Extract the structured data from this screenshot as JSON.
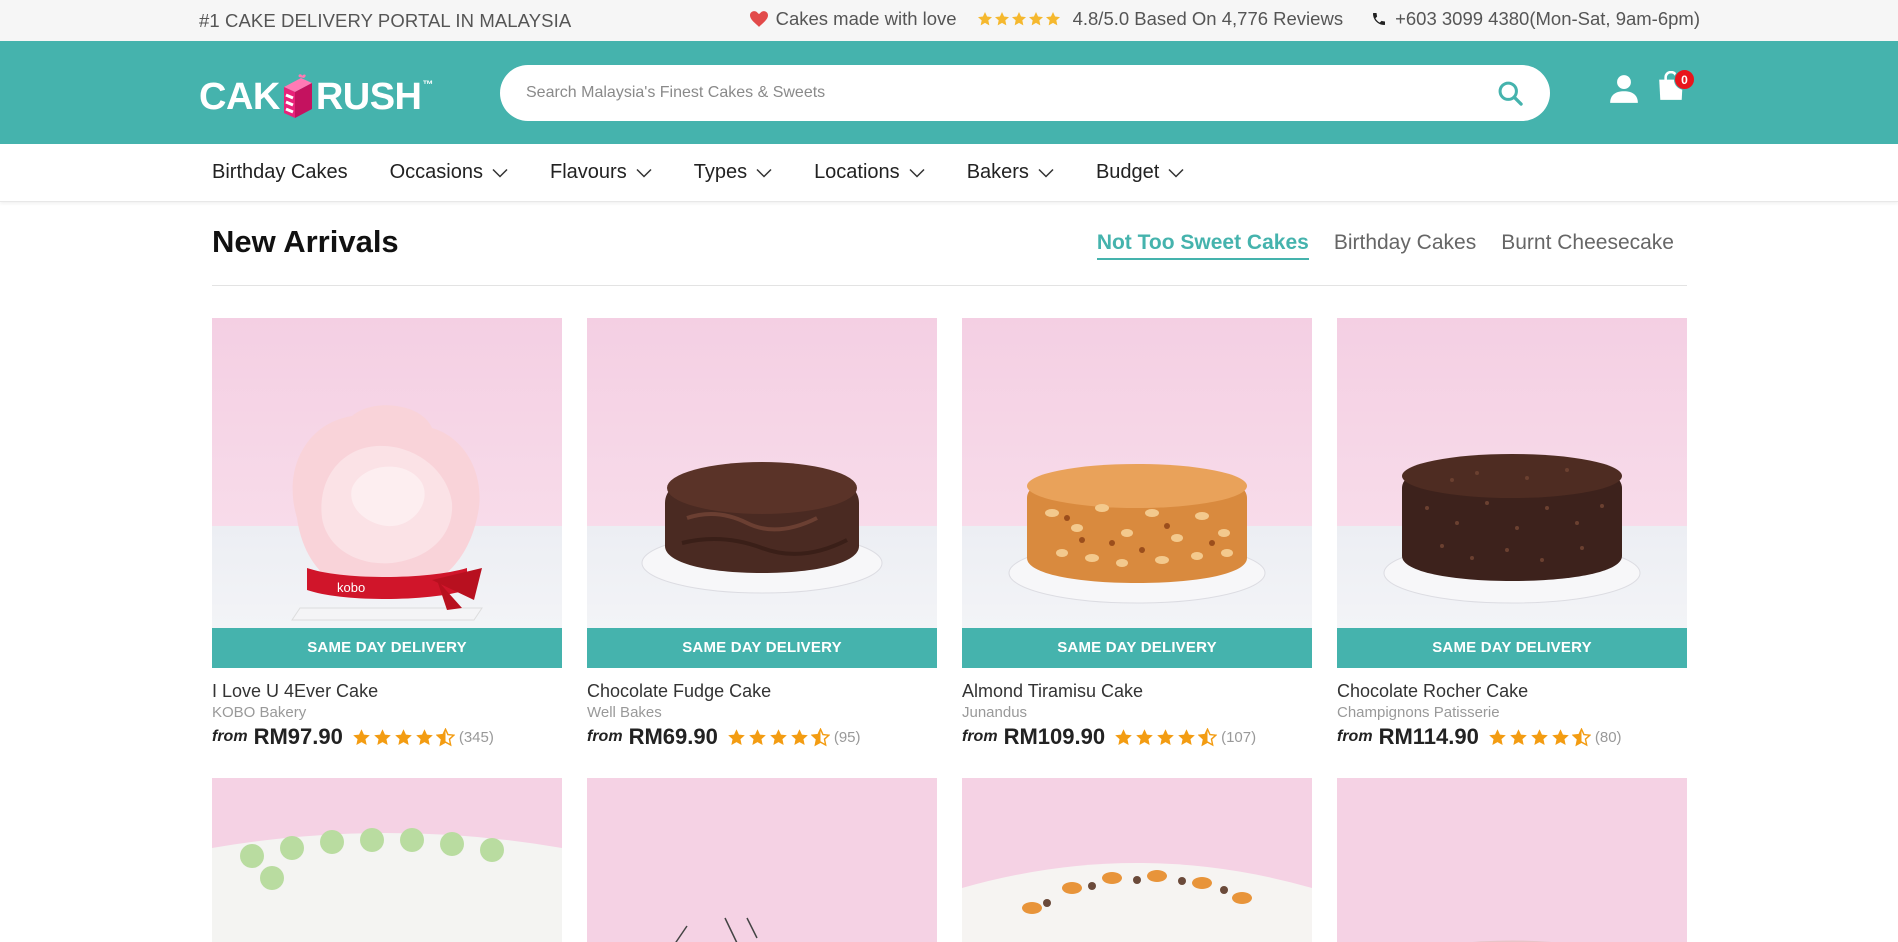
{
  "topbar": {
    "tagline": "#1 CAKE DELIVERY PORTAL IN MALAYSIA",
    "love_text": "Cakes made with love",
    "rating_text": "4.8/5.0 Based On 4,776 Reviews",
    "phone_text": "+603 3099 4380(Mon-Sat, 9am-6pm)"
  },
  "header": {
    "logo_left": "CAK",
    "logo_right": "RUSH",
    "logo_tm": "™",
    "search_placeholder": "Search Malaysia's Finest Cakes & Sweets",
    "cart_count": "0"
  },
  "nav": {
    "items": [
      {
        "label": "Birthday Cakes"
      },
      {
        "label": "Occasions"
      },
      {
        "label": "Flavours"
      },
      {
        "label": "Types"
      },
      {
        "label": "Locations"
      },
      {
        "label": "Bakers"
      },
      {
        "label": "Budget"
      }
    ]
  },
  "section": {
    "title": "New Arrivals",
    "tabs": [
      {
        "label": "Not Too Sweet Cakes",
        "active": true
      },
      {
        "label": "Birthday Cakes",
        "active": false
      },
      {
        "label": "Burnt Cheesecake",
        "active": false
      }
    ]
  },
  "products": [
    {
      "badge": "SAME DAY DELIVERY",
      "name": "I Love U 4Ever Cake",
      "baker": "KOBO Bakery",
      "from": "from",
      "price": "RM97.90",
      "rating": 4.5,
      "reviews": "(345)"
    },
    {
      "badge": "SAME DAY DELIVERY",
      "name": "Chocolate Fudge Cake",
      "baker": "Well Bakes",
      "from": "from",
      "price": "RM69.90",
      "rating": 4.5,
      "reviews": "(95)"
    },
    {
      "badge": "SAME DAY DELIVERY",
      "name": "Almond Tiramisu Cake",
      "baker": "Junandus",
      "from": "from",
      "price": "RM109.90",
      "rating": 4.5,
      "reviews": "(107)"
    },
    {
      "badge": "SAME DAY DELIVERY",
      "name": "Chocolate Rocher Cake",
      "baker": "Champignons Patisserie",
      "from": "from",
      "price": "RM114.90",
      "rating": 4.5,
      "reviews": "(80)"
    }
  ],
  "colors": {
    "brand_teal": "#45b3ad",
    "star_orange": "#f39c12",
    "heart_red": "#e24a4a",
    "badge_red": "#e8151c"
  },
  "icons": {
    "search": "search-icon",
    "user": "user-icon",
    "cart": "shopping-bag-icon",
    "heart": "heart-icon",
    "phone": "phone-icon",
    "chevron": "chevron-down-icon",
    "star": "star-icon"
  }
}
